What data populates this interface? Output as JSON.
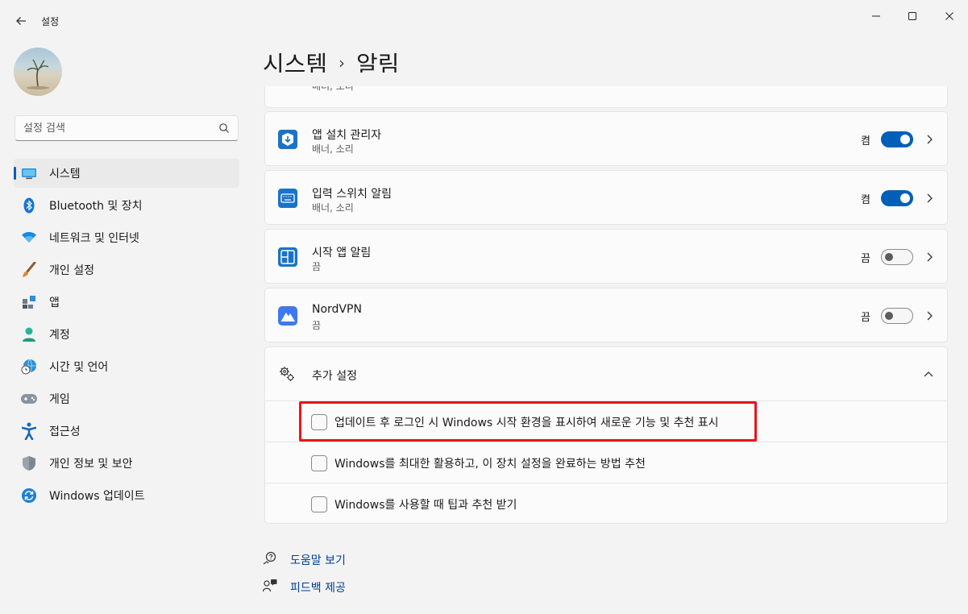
{
  "window": {
    "app_title": "설정",
    "back_icon": "back-arrow-icon",
    "controls": [
      "minimize-icon",
      "maximize-icon",
      "close-icon"
    ]
  },
  "sidebar": {
    "search": {
      "placeholder": "설정 검색",
      "icon": "search-icon"
    },
    "items": [
      {
        "label": "시스템",
        "icon": "system-icon",
        "selected": true
      },
      {
        "label": "Bluetooth 및 장치",
        "icon": "bluetooth-icon"
      },
      {
        "label": "네트워크 및 인터넷",
        "icon": "wifi-icon"
      },
      {
        "label": "개인 설정",
        "icon": "brush-icon"
      },
      {
        "label": "앱",
        "icon": "apps-icon"
      },
      {
        "label": "계정",
        "icon": "account-icon"
      },
      {
        "label": "시간 및 언어",
        "icon": "globe-clock-icon"
      },
      {
        "label": "게임",
        "icon": "gamepad-icon"
      },
      {
        "label": "접근성",
        "icon": "accessibility-icon"
      },
      {
        "label": "개인 정보 및 보안",
        "icon": "shield-icon"
      },
      {
        "label": "Windows 업데이트",
        "icon": "update-icon"
      }
    ]
  },
  "main": {
    "breadcrumb": {
      "parent": "시스템",
      "separator": "›",
      "current": "알림"
    },
    "partial_row": {
      "subtitle": "배너, 소리"
    },
    "apps": [
      {
        "name": "앱 설치 관리자",
        "subtitle": "배너, 소리",
        "state_label": "켬",
        "on": true,
        "icon": "app-installer-icon"
      },
      {
        "name": "입력 스위치 알림",
        "subtitle": "배너, 소리",
        "state_label": "켬",
        "on": true,
        "icon": "keyboard-icon"
      },
      {
        "name": "시작 앱 알림",
        "subtitle": "끔",
        "state_label": "끔",
        "on": false,
        "icon": "startup-apps-icon"
      },
      {
        "name": "NordVPN",
        "subtitle": "끔",
        "state_label": "끔",
        "on": false,
        "icon": "nordvpn-icon"
      }
    ],
    "additional": {
      "title": "추가 설정",
      "icon": "gears-icon",
      "expanded": true,
      "options": [
        {
          "label": "업데이트 후 로그인 시 Windows 시작 환경을 표시하여 새로운 기능 및 추천 표시",
          "checked": false
        },
        {
          "label": "Windows를 최대한 활용하고, 이 장치 설정을 완료하는 방법 추천",
          "checked": false
        },
        {
          "label": "Windows를 사용할 때 팁과 추천 받기",
          "checked": false
        }
      ]
    },
    "links": [
      {
        "label": "도움말 보기",
        "icon": "help-icon"
      },
      {
        "label": "피드백 제공",
        "icon": "feedback-icon"
      }
    ]
  },
  "colors": {
    "accent": "#005fb8",
    "highlight": "#e8141c",
    "background": "#f3f3f3",
    "card": "#fbfbfb"
  }
}
